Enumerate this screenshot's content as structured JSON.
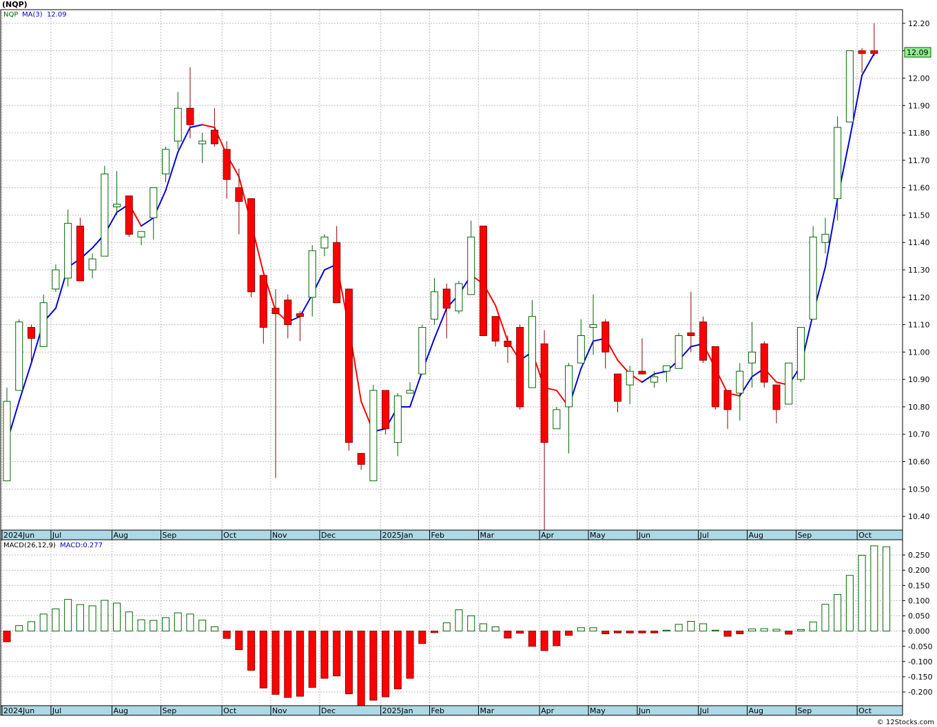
{
  "header": {
    "symbol": "(NQP)",
    "legend_symbol": "NQP",
    "legend_ma_label": "MA(3)",
    "legend_ma_value": "12.09",
    "last_price_tag": "12.09"
  },
  "macd_header": {
    "label": "MACD(26,12,9)",
    "value_label": "MACD:0.277"
  },
  "watermark": "© 12Stocks.com",
  "colors": {
    "up_body": "#ffffff",
    "up_outline": "#006400",
    "down_body": "#ff0000",
    "down_outline": "#8b0000",
    "ma_up": "#0000dd",
    "ma_down": "#ff0000",
    "grid": "#bbbbbb",
    "axis_band": "#add8e6",
    "price_tag_bg": "#90ee90"
  },
  "chart_data": [
    {
      "type": "candlestick",
      "title": "(NQP)",
      "ylim": [
        10.35,
        12.25
      ],
      "yticks": [
        "10.40",
        "10.50",
        "10.60",
        "10.70",
        "10.80",
        "10.90",
        "11.00",
        "11.10",
        "11.20",
        "11.30",
        "11.40",
        "11.50",
        "11.60",
        "11.70",
        "11.80",
        "11.90",
        "12.00",
        "12.10",
        "12.20"
      ],
      "month_labels": [
        {
          "label": "2024Jun",
          "week": 0
        },
        {
          "label": "Jul",
          "week": 4
        },
        {
          "label": "Aug",
          "week": 9
        },
        {
          "label": "Sep",
          "week": 13
        },
        {
          "label": "Oct",
          "week": 18
        },
        {
          "label": "Nov",
          "week": 22
        },
        {
          "label": "Dec",
          "week": 26
        },
        {
          "label": "2025Jan",
          "week": 31
        },
        {
          "label": "Feb",
          "week": 35
        },
        {
          "label": "Mar",
          "week": 39
        },
        {
          "label": "Apr",
          "week": 44
        },
        {
          "label": "May",
          "week": 48
        },
        {
          "label": "Jun",
          "week": 52
        },
        {
          "label": "Jul",
          "week": 57
        },
        {
          "label": "Aug",
          "week": 61
        },
        {
          "label": "Sep",
          "week": 65
        },
        {
          "label": "Oct",
          "week": 70
        }
      ],
      "candles": [
        {
          "o": 10.53,
          "h": 10.87,
          "l": 10.53,
          "c": 10.82
        },
        {
          "o": 10.86,
          "h": 11.12,
          "l": 10.86,
          "c": 11.11
        },
        {
          "o": 11.09,
          "h": 11.1,
          "l": 10.96,
          "c": 11.05
        },
        {
          "o": 11.02,
          "h": 11.21,
          "l": 11.02,
          "c": 11.18
        },
        {
          "o": 11.23,
          "h": 11.32,
          "l": 11.22,
          "c": 11.3
        },
        {
          "o": 11.27,
          "h": 11.52,
          "l": 11.24,
          "c": 11.47
        },
        {
          "o": 11.46,
          "h": 11.49,
          "l": 11.26,
          "c": 11.26
        },
        {
          "o": 11.3,
          "h": 11.36,
          "l": 11.27,
          "c": 11.34
        },
        {
          "o": 11.35,
          "h": 11.68,
          "l": 11.35,
          "c": 11.65
        },
        {
          "o": 11.53,
          "h": 11.66,
          "l": 11.5,
          "c": 11.54
        },
        {
          "o": 11.57,
          "h": 11.57,
          "l": 11.42,
          "c": 11.43
        },
        {
          "o": 11.42,
          "h": 11.44,
          "l": 11.39,
          "c": 11.44
        },
        {
          "o": 11.49,
          "h": 11.6,
          "l": 11.41,
          "c": 11.6
        },
        {
          "o": 11.65,
          "h": 11.75,
          "l": 11.62,
          "c": 11.74
        },
        {
          "o": 11.77,
          "h": 11.95,
          "l": 11.74,
          "c": 11.89
        },
        {
          "o": 11.89,
          "h": 12.04,
          "l": 11.78,
          "c": 11.83
        },
        {
          "o": 11.76,
          "h": 11.8,
          "l": 11.69,
          "c": 11.77
        },
        {
          "o": 11.81,
          "h": 11.89,
          "l": 11.75,
          "c": 11.76
        },
        {
          "o": 11.74,
          "h": 11.77,
          "l": 11.56,
          "c": 11.63
        },
        {
          "o": 11.6,
          "h": 11.67,
          "l": 11.43,
          "c": 11.55
        },
        {
          "o": 11.56,
          "h": 11.56,
          "l": 11.2,
          "c": 11.22
        },
        {
          "o": 11.28,
          "h": 11.28,
          "l": 11.03,
          "c": 11.09
        },
        {
          "o": 11.16,
          "h": 11.23,
          "l": 10.54,
          "c": 11.14
        },
        {
          "o": 11.19,
          "h": 11.21,
          "l": 11.05,
          "c": 11.1
        },
        {
          "o": 11.14,
          "h": 11.15,
          "l": 11.04,
          "c": 11.13
        },
        {
          "o": 11.2,
          "h": 11.39,
          "l": 11.13,
          "c": 11.37
        },
        {
          "o": 11.38,
          "h": 11.43,
          "l": 11.35,
          "c": 11.42
        },
        {
          "o": 11.4,
          "h": 11.46,
          "l": 11.18,
          "c": 11.18
        },
        {
          "o": 11.23,
          "h": 11.23,
          "l": 10.64,
          "c": 10.67
        },
        {
          "o": 10.63,
          "h": 10.63,
          "l": 10.57,
          "c": 10.59
        },
        {
          "o": 10.53,
          "h": 10.88,
          "l": 10.53,
          "c": 10.86
        },
        {
          "o": 10.86,
          "h": 10.86,
          "l": 10.7,
          "c": 10.72
        },
        {
          "o": 10.67,
          "h": 10.85,
          "l": 10.62,
          "c": 10.84
        },
        {
          "o": 10.85,
          "h": 10.89,
          "l": 10.85,
          "c": 10.86
        },
        {
          "o": 10.92,
          "h": 11.1,
          "l": 10.92,
          "c": 11.09
        },
        {
          "o": 11.12,
          "h": 11.27,
          "l": 11.1,
          "c": 11.22
        },
        {
          "o": 11.23,
          "h": 11.25,
          "l": 11.05,
          "c": 11.16
        },
        {
          "o": 11.15,
          "h": 11.26,
          "l": 11.14,
          "c": 11.25
        },
        {
          "o": 11.21,
          "h": 11.48,
          "l": 11.21,
          "c": 11.42
        },
        {
          "o": 11.46,
          "h": 11.46,
          "l": 11.06,
          "c": 11.06
        },
        {
          "o": 11.13,
          "h": 11.13,
          "l": 11.02,
          "c": 11.04
        },
        {
          "o": 11.04,
          "h": 11.06,
          "l": 10.96,
          "c": 11.02
        },
        {
          "o": 11.09,
          "h": 11.1,
          "l": 10.79,
          "c": 10.8
        },
        {
          "o": 10.87,
          "h": 11.19,
          "l": 10.87,
          "c": 11.13
        },
        {
          "o": 11.03,
          "h": 11.08,
          "l": 10.35,
          "c": 10.67
        },
        {
          "o": 10.72,
          "h": 10.8,
          "l": 10.72,
          "c": 10.79
        },
        {
          "o": 10.8,
          "h": 10.96,
          "l": 10.63,
          "c": 10.95
        },
        {
          "o": 10.96,
          "h": 11.12,
          "l": 10.96,
          "c": 11.06
        },
        {
          "o": 11.09,
          "h": 11.21,
          "l": 10.99,
          "c": 11.1
        },
        {
          "o": 11.11,
          "h": 11.12,
          "l": 10.94,
          "c": 11.0
        },
        {
          "o": 10.92,
          "h": 10.92,
          "l": 10.78,
          "c": 10.82
        },
        {
          "o": 10.88,
          "h": 10.95,
          "l": 10.81,
          "c": 10.93
        },
        {
          "o": 10.93,
          "h": 11.05,
          "l": 10.93,
          "c": 10.92
        },
        {
          "o": 10.89,
          "h": 10.93,
          "l": 10.87,
          "c": 10.91
        },
        {
          "o": 10.93,
          "h": 10.95,
          "l": 10.89,
          "c": 10.95
        },
        {
          "o": 10.94,
          "h": 11.07,
          "l": 10.94,
          "c": 11.06
        },
        {
          "o": 11.07,
          "h": 11.22,
          "l": 11.0,
          "c": 11.06
        },
        {
          "o": 11.11,
          "h": 11.13,
          "l": 10.96,
          "c": 10.97
        },
        {
          "o": 11.02,
          "h": 11.02,
          "l": 10.79,
          "c": 10.8
        },
        {
          "o": 10.86,
          "h": 10.86,
          "l": 10.72,
          "c": 10.79
        },
        {
          "o": 10.85,
          "h": 10.96,
          "l": 10.75,
          "c": 10.93
        },
        {
          "o": 10.96,
          "h": 11.11,
          "l": 10.87,
          "c": 11.0
        },
        {
          "o": 11.03,
          "h": 11.04,
          "l": 10.87,
          "c": 10.89
        },
        {
          "o": 10.88,
          "h": 10.88,
          "l": 10.74,
          "c": 10.79
        },
        {
          "o": 10.81,
          "h": 10.96,
          "l": 10.81,
          "c": 10.96
        },
        {
          "o": 10.9,
          "h": 11.09,
          "l": 10.89,
          "c": 11.09
        },
        {
          "o": 11.12,
          "h": 11.46,
          "l": 11.12,
          "c": 11.42
        },
        {
          "o": 11.4,
          "h": 11.49,
          "l": 11.36,
          "c": 11.43
        },
        {
          "o": 11.56,
          "h": 11.86,
          "l": 11.48,
          "c": 11.82
        },
        {
          "o": 11.84,
          "h": 12.1,
          "l": 11.84,
          "c": 12.1
        },
        {
          "o": 12.1,
          "h": 12.11,
          "l": 12.02,
          "c": 12.09
        },
        {
          "o": 12.1,
          "h": 12.2,
          "l": 12.08,
          "c": 12.09
        }
      ],
      "ma3": [
        10.67,
        10.82,
        10.96,
        11.11,
        11.16,
        11.31,
        11.34,
        11.38,
        11.43,
        11.51,
        11.54,
        11.46,
        11.49,
        11.59,
        11.73,
        11.82,
        11.83,
        11.82,
        11.72,
        11.64,
        11.47,
        11.29,
        11.15,
        11.11,
        11.13,
        11.21,
        11.3,
        11.32,
        11.09,
        10.82,
        10.71,
        10.72,
        10.8,
        10.8,
        10.93,
        11.05,
        11.16,
        11.21,
        11.28,
        11.25,
        11.17,
        11.04,
        10.97,
        11.0,
        10.87,
        10.86,
        10.8,
        10.94,
        11.04,
        11.05,
        10.97,
        10.92,
        10.89,
        10.92,
        10.93,
        10.97,
        11.02,
        11.03,
        10.94,
        10.85,
        10.84,
        10.91,
        10.94,
        10.89,
        10.88,
        10.95,
        11.14,
        11.31,
        11.56,
        11.78,
        12.01,
        12.09
      ]
    },
    {
      "type": "bar",
      "title": "MACD(26,12,9)",
      "ylim": [
        -0.245,
        0.3
      ],
      "yticks": [
        "-0.200",
        "-0.150",
        "-0.100",
        "-0.050",
        "0.000",
        "0.050",
        "0.100",
        "0.150",
        "0.200",
        "0.250"
      ],
      "month_labels": [
        "2024Jun",
        "Jul",
        "Aug",
        "Sep",
        "Oct",
        "Nov",
        "Dec",
        "2025Jan",
        "Feb",
        "Mar",
        "Apr",
        "May",
        "Jun",
        "Jul",
        "Aug",
        "Sep",
        "Oct"
      ],
      "values": [
        -0.035,
        0.018,
        0.031,
        0.056,
        0.073,
        0.104,
        0.087,
        0.083,
        0.101,
        0.092,
        0.063,
        0.037,
        0.035,
        0.044,
        0.06,
        0.056,
        0.036,
        0.014,
        -0.024,
        -0.061,
        -0.129,
        -0.187,
        -0.208,
        -0.218,
        -0.214,
        -0.185,
        -0.155,
        -0.147,
        -0.206,
        -0.245,
        -0.227,
        -0.216,
        -0.19,
        -0.155,
        -0.041,
        -0.005,
        0.027,
        0.07,
        0.05,
        0.024,
        0.014,
        -0.023,
        -0.007,
        -0.05,
        -0.064,
        -0.048,
        -0.014,
        0.011,
        0.011,
        -0.009,
        -0.006,
        -0.006,
        -0.006,
        -0.006,
        0.003,
        0.022,
        0.032,
        0.024,
        0.003,
        -0.017,
        -0.009,
        0.007,
        0.008,
        0.006,
        -0.01,
        0.005,
        0.03,
        0.088,
        0.12,
        0.183,
        0.249,
        0.28,
        0.277
      ]
    }
  ]
}
